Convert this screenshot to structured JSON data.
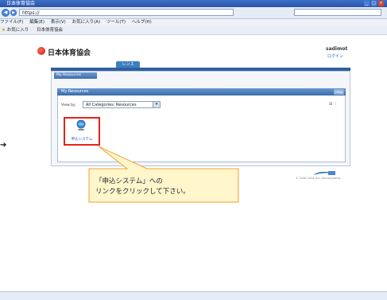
{
  "browser": {
    "title": "日本体育協会",
    "address": "https://",
    "search_placeholder": "",
    "menu": [
      "ファイル(F)",
      "編集(E)",
      "表示(V)",
      "お気に入り(A)",
      "ツール(T)",
      "ヘルプ(H)"
    ],
    "favorites_label": "お気に入り",
    "favorites_tab": "日本体育協会"
  },
  "header": {
    "org_name": "日本体育協会",
    "user_name": "sadimot",
    "login_link": "ログイン"
  },
  "nav": {
    "tab_label": "レンス"
  },
  "resources": {
    "outer_tab": "My Resources",
    "panel_title": "My Resources",
    "help_label": "Help",
    "filter_label": "View by",
    "filter_value": "All Categories: Resources",
    "app_label": "申込システム"
  },
  "callout": {
    "line1": "「申込システム」への",
    "line2": "リンクをクリックして下さい。",
    "colors": {
      "fill": "#fff6cc",
      "stroke": "#f0a030",
      "highlight": "#e3231b"
    }
  },
  "footer": {
    "copyright": "© 2006-2008 Sun Microsystems"
  }
}
